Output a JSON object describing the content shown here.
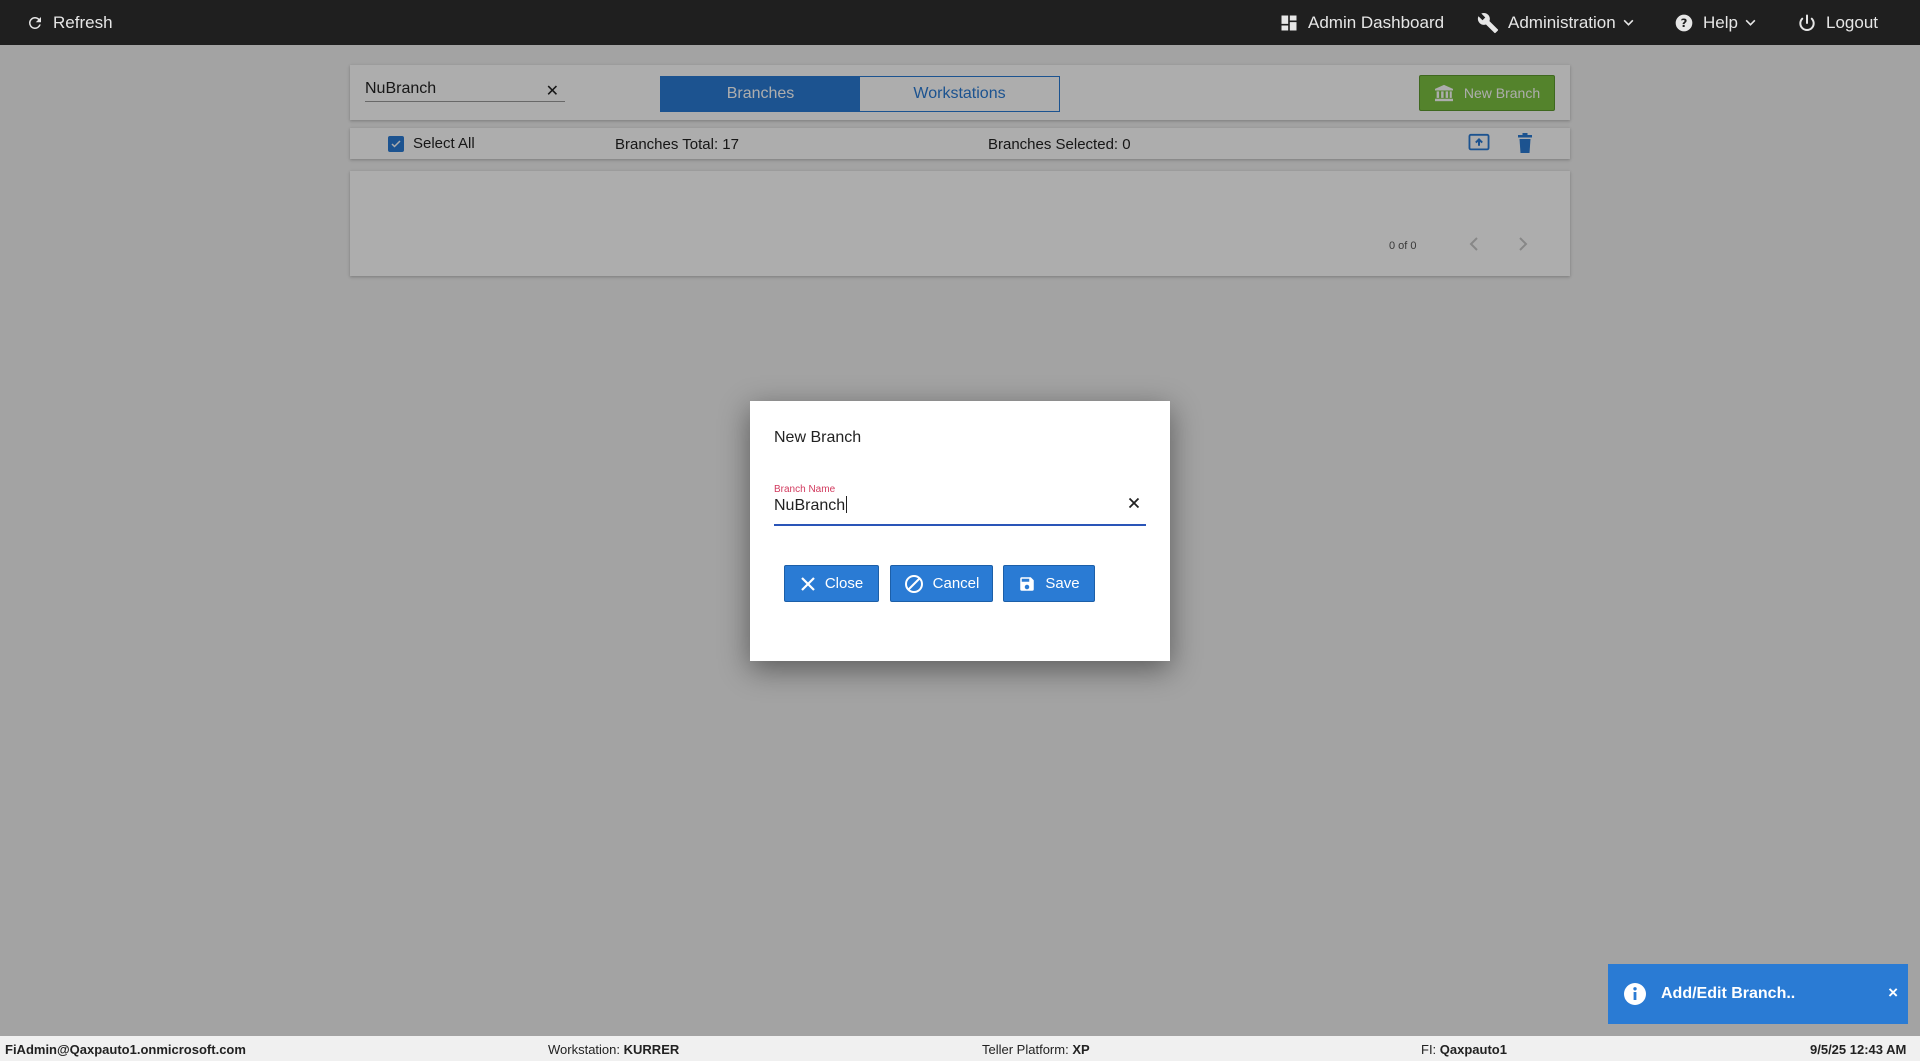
{
  "topbar": {
    "refresh_label": "Refresh",
    "admin_dashboard_label": "Admin Dashboard",
    "administration_label": "Administration",
    "help_label": "Help",
    "logout_label": "Logout"
  },
  "search": {
    "value": "NuBranch",
    "clear_glyph": "✕"
  },
  "tabs": [
    {
      "label": "Branches",
      "active": true
    },
    {
      "label": "Workstations",
      "active": false
    }
  ],
  "new_branch_button": {
    "label": "New Branch",
    "icon": "bank-icon",
    "color": "#7cc241"
  },
  "select_bar": {
    "select_all_label": "Select All",
    "select_all_checked": true,
    "branches_total_label": "Branches Total: 17",
    "branches_selected_label": "Branches Selected: 0"
  },
  "list": {
    "pager_text": "0 of 0"
  },
  "dialog": {
    "title": "New Branch",
    "field_label": "Branch Name",
    "field_value": "NuBranch",
    "close_label": "Close",
    "cancel_label": "Cancel",
    "save_label": "Save"
  },
  "toast": {
    "message": "Add/Edit Branch..",
    "close_glyph": "×",
    "icon": "info-icon"
  },
  "footer": {
    "user": "FiAdmin@Qaxpauto1.onmicrosoft.com",
    "workstation_label": "Workstation:",
    "workstation_value": "KURRER",
    "platform_label": "Teller Platform:",
    "platform_value": "XP",
    "fi_label": "FI:",
    "fi_value": "Qaxpauto1",
    "datetime": "9/5/25 12:43 AM"
  },
  "colors": {
    "accent": "#2a7bd4",
    "topbar": "#1f1f1f",
    "success": "#7cc241",
    "field_label": "#d23a5e"
  }
}
